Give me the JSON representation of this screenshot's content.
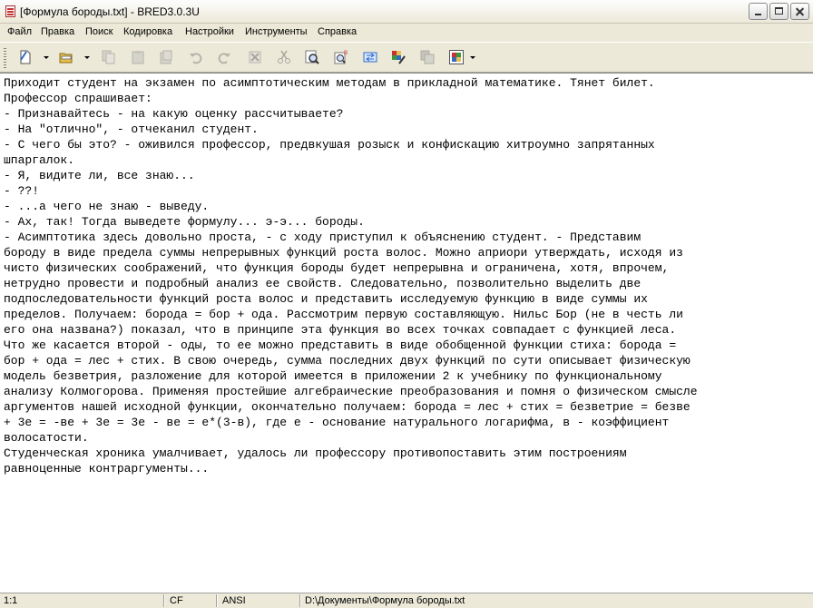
{
  "window": {
    "title": "[Формула бороды.txt] - BRED3.0.3U"
  },
  "menu": [
    "Файл",
    "Правка",
    "Поиск",
    "Кодировка",
    "Настройки",
    "Инструменты",
    "Справка"
  ],
  "toolbar": {
    "icons": [
      "new-file-icon",
      "open-folder-icon",
      "copy-icon",
      "paste-icon",
      "clipboard-icon",
      "undo-icon",
      "redo-icon",
      "delete-icon",
      "cut-icon",
      "find-icon",
      "spellcheck-icon",
      "replace-icon",
      "color-palette-icon",
      "copy-format-icon",
      "windows-flag-icon"
    ],
    "colors": {
      "accent": "#316ac5",
      "red": "#c83232",
      "folder": "#e8c050"
    }
  },
  "editor": {
    "lines": [
      "Приходит студент на экзамен по асимптотическим методам в прикладной математике. Тянет билет.",
      "Профессор спрашивает:",
      "- Признавайтесь - на какую оценку рассчитываете?",
      "- На \"отлично\", - отчеканил студент.",
      "- С чего бы это? - оживился профессор, предвкушая розыск и конфискацию хитроумно запрятанных",
      "шпаргалок.",
      "- Я, видите ли, все знаю...",
      "- ??!",
      "- ...а чего не знаю - выведу.",
      "- Ах, так! Тогда выведете формулу... э-э... бороды.",
      "- Асимптотика здесь довольно проста, - с ходу приступил к объяснению студент. - Представим",
      "бороду в виде предела суммы непрерывных функций роста волос. Можно априори утверждать, исходя из",
      "чисто физических соображений, что функция бороды будет непрерывна и ограничена, хотя, впрочем,",
      "нетрудно провести и подробный анализ ее свойств. Следовательно, позволительно выделить две",
      "подпоследовательности функций роста волос и представить исследуемую функцию в виде суммы их",
      "пределов. Получаем: борода = бор + ода. Рассмотрим первую составляющую. Нильс Бор (не в честь ли",
      "его она названа?) показал, что в принципе эта функция во всех точках совпадает с функцией леса.",
      "Что же касается второй - оды, то ее можно представить в виде обобщенной функции стиха: борода =",
      "бор + ода = лес + стих. В свою очередь, сумма последних двух функций по сути описывает физическую",
      "модель безветрия, разложение для которой имеется в приложении 2 к учебнику по функциональному",
      "анализу Колмогорова. Применяя простейшие алгебраические преобразования и помня о физическом смысле",
      "аргументов нашей исходной функции, окончательно получаем: борода = лес + стих = безветрие = безве",
      "+ 3е = -ве + 3е = 3е - ве = е*(3-в), где е - основание натурального логарифма, в - коэффициент",
      "волосатости.",
      "Студенческая хроника умалчивает, удалось ли профессору противопоставить этим построениям",
      "равноценные контраргументы..."
    ]
  },
  "status": {
    "position": "1:1",
    "line_ending": "CF",
    "encoding": "ANSI",
    "path": "D:\\Документы\\Формула бороды.txt"
  }
}
